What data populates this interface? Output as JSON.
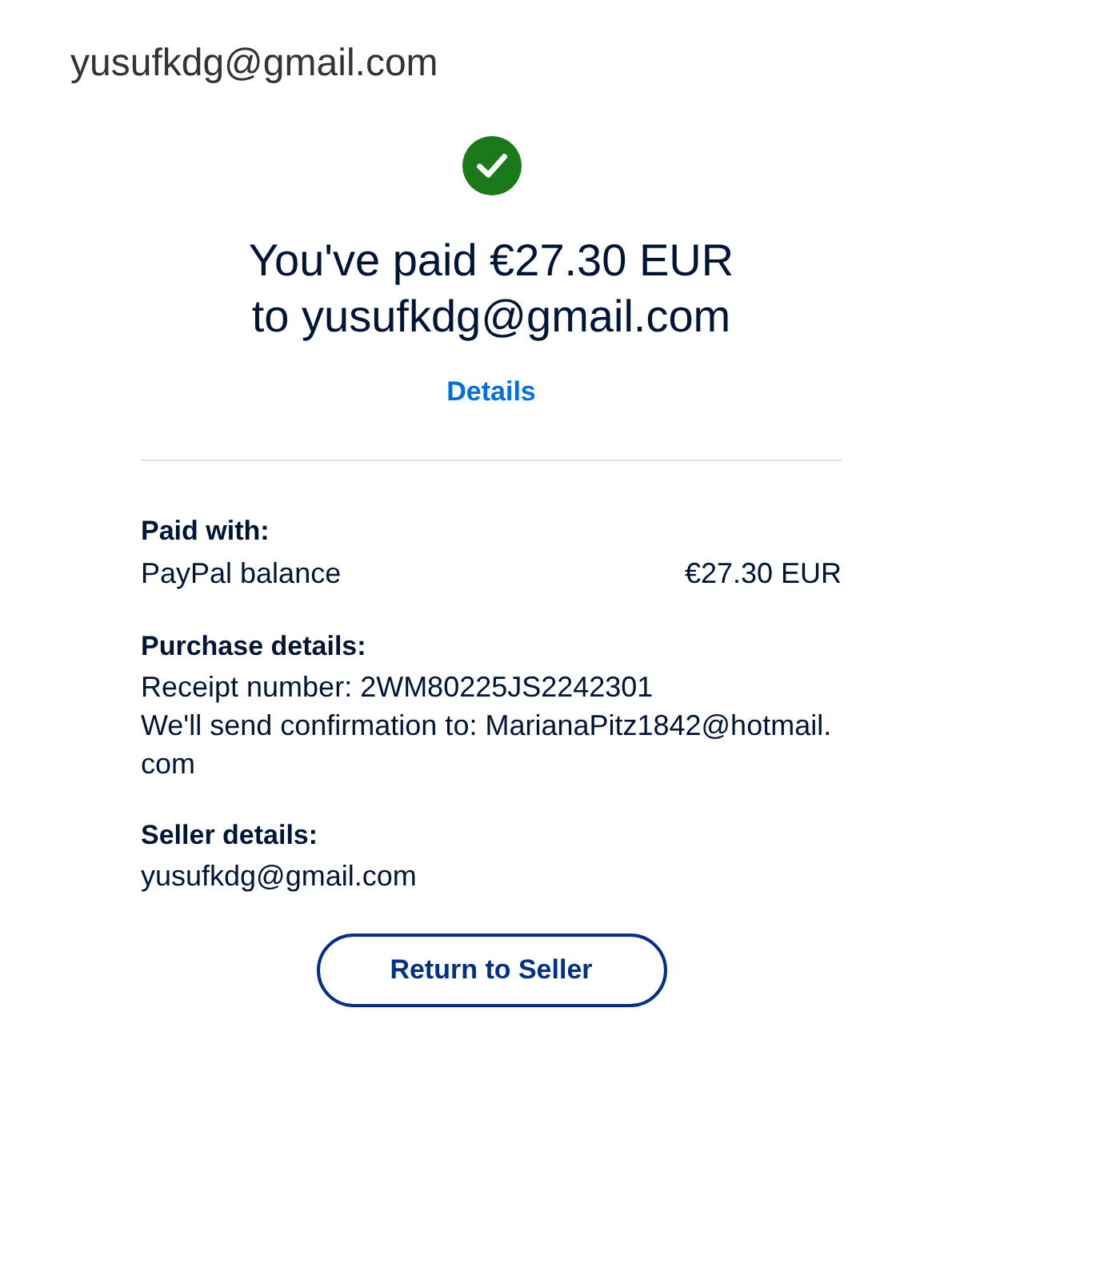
{
  "header": {
    "email": "yusufkdg@gmail.com"
  },
  "title": "You've paid €27.30 EUR to yusufkdg@gmail.com",
  "details_link": "Details",
  "sections": [
    {
      "heading": "Paid with:",
      "rows": [
        {
          "label": "PayPal balance",
          "value": "€27.30 EUR"
        }
      ]
    },
    {
      "heading": "Purchase details:",
      "lines": [
        "Receipt number: 2WM80225JS2242301",
        "We'll send confirmation to: MarianaPitz1842@hotmail.com"
      ]
    },
    {
      "heading": "Seller details:",
      "lines": [
        "yusufkdg@gmail.com"
      ]
    }
  ],
  "button": "Return to Seller"
}
